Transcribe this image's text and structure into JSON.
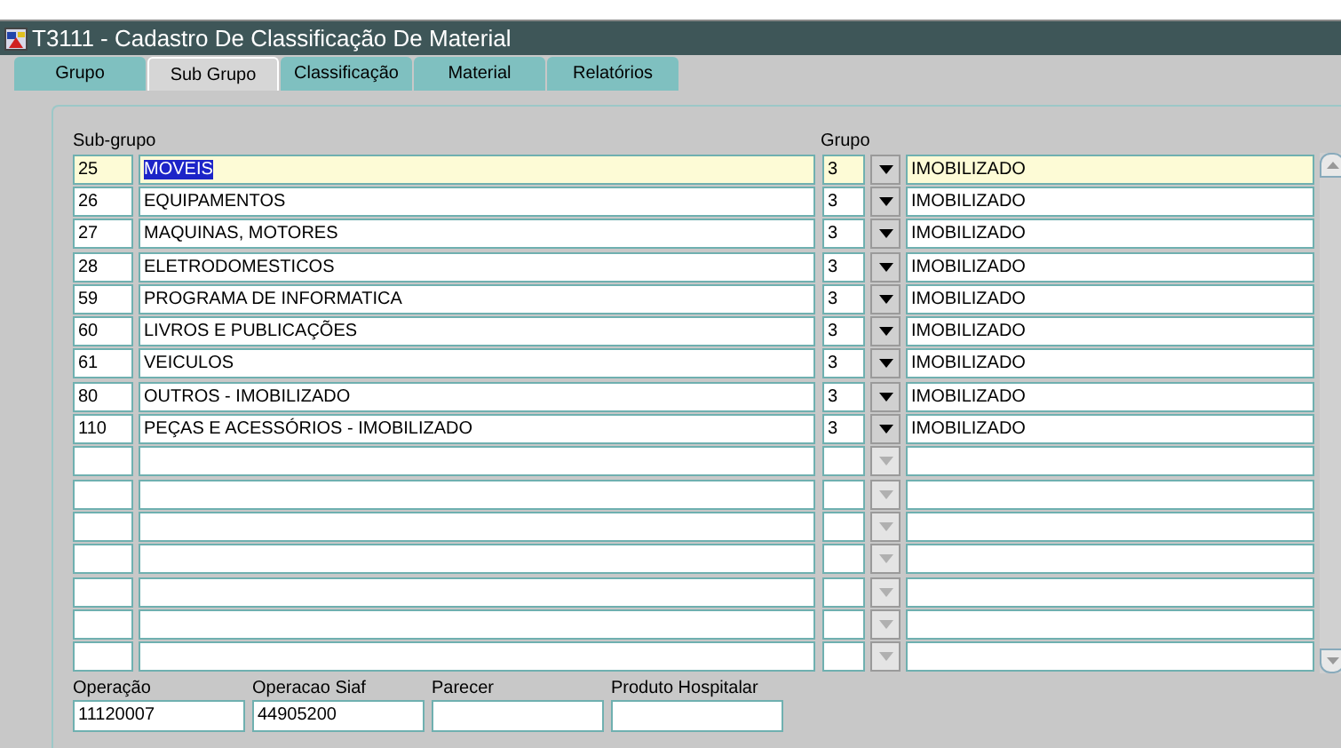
{
  "window": {
    "title": "T3111 - Cadastro De Classificação De Material"
  },
  "tabs": [
    {
      "label": "Grupo",
      "selected": false
    },
    {
      "label": "Sub Grupo",
      "selected": true
    },
    {
      "label": "Classificação",
      "selected": false
    },
    {
      "label": "Material",
      "selected": false
    },
    {
      "label": "Relatórios",
      "selected": false
    }
  ],
  "table": {
    "columns": [
      "Sub-grupo",
      "Grupo"
    ],
    "rows": [
      {
        "code": "25",
        "name": "MOVEIS",
        "group": "3",
        "group_name": "IMOBILIZADO",
        "selected": true
      },
      {
        "code": "26",
        "name": "EQUIPAMENTOS",
        "group": "3",
        "group_name": "IMOBILIZADO",
        "selected": false
      },
      {
        "code": "27",
        "name": "MAQUINAS, MOTORES",
        "group": "3",
        "group_name": "IMOBILIZADO",
        "selected": false
      },
      {
        "code": "28",
        "name": "ELETRODOMESTICOS",
        "group": "3",
        "group_name": "IMOBILIZADO",
        "selected": false
      },
      {
        "code": "59",
        "name": "PROGRAMA DE INFORMATICA",
        "group": "3",
        "group_name": "IMOBILIZADO",
        "selected": false
      },
      {
        "code": "60",
        "name": "LIVROS E PUBLICAÇÕES",
        "group": "3",
        "group_name": "IMOBILIZADO",
        "selected": false
      },
      {
        "code": "61",
        "name": "VEICULOS",
        "group": "3",
        "group_name": "IMOBILIZADO",
        "selected": false
      },
      {
        "code": "80",
        "name": "OUTROS - IMOBILIZADO",
        "group": "3",
        "group_name": "IMOBILIZADO",
        "selected": false
      },
      {
        "code": "110",
        "name": "PEÇAS E ACESSÓRIOS - IMOBILIZADO",
        "group": "3",
        "group_name": "IMOBILIZADO",
        "selected": false
      }
    ]
  },
  "fields": [
    {
      "label": "Operação",
      "value": "11120007"
    },
    {
      "label": "Operacao Siaf",
      "value": "44905200"
    },
    {
      "label": "Parecer"
    },
    {
      "label": "Produto Hospitalar"
    }
  ]
}
